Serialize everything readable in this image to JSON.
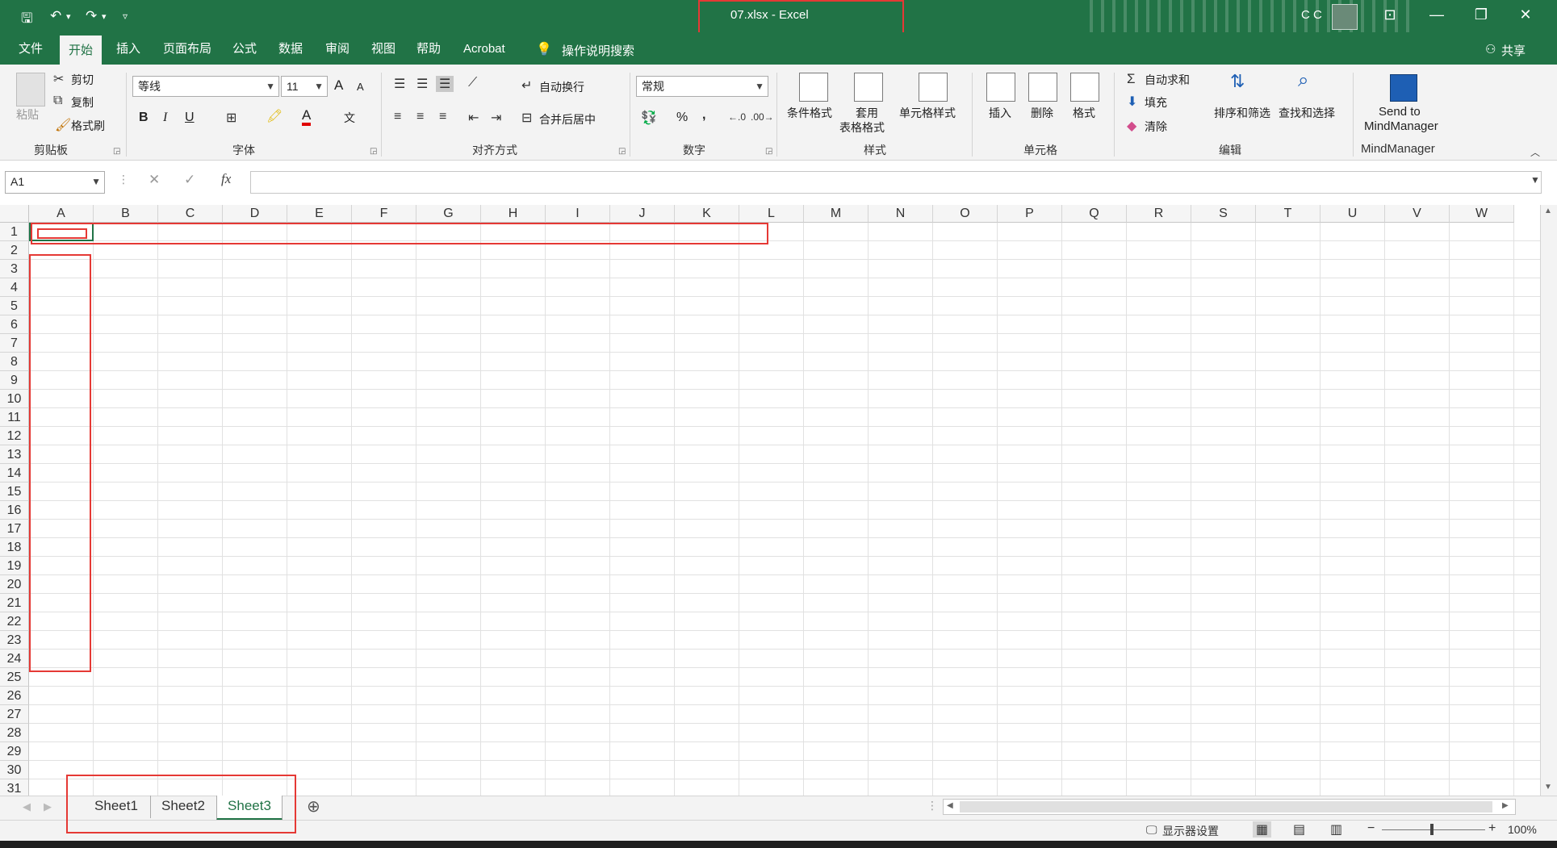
{
  "window": {
    "title": "07.xlsx  -  Excel",
    "user": "C C",
    "share_label": "共享"
  },
  "tabs": [
    "文件",
    "开始",
    "插入",
    "页面布局",
    "公式",
    "数据",
    "审阅",
    "视图",
    "帮助",
    "Acrobat"
  ],
  "active_tab": "开始",
  "tell_me": "操作说明搜索",
  "ribbon": {
    "clipboard": {
      "label": "剪贴板",
      "paste": "粘贴",
      "cut": "剪切",
      "copy": "复制",
      "format_painter": "格式刷"
    },
    "font": {
      "label": "字体",
      "font_name": "等线",
      "font_size": "11",
      "bold": "B",
      "italic": "I",
      "underline": "U",
      "grow": "A",
      "shrink": "A",
      "font_color_glyph": "A",
      "phonetic": "文"
    },
    "alignment": {
      "label": "对齐方式",
      "wrap": "自动换行",
      "merge": "合并后居中"
    },
    "number": {
      "label": "数字",
      "format": "常规",
      "percent": "%",
      "comma": ","
    },
    "styles": {
      "label": "样式",
      "conditional": "条件格式",
      "table_format_1": "套用",
      "table_format_2": "表格格式",
      "cell_styles": "单元格样式"
    },
    "cells": {
      "label": "单元格",
      "insert": "插入",
      "delete": "删除",
      "format": "格式"
    },
    "editing": {
      "label": "编辑",
      "autosum": "自动求和",
      "fill": "填充",
      "clear": "清除",
      "sort": "排序和筛选",
      "find": "查找和选择"
    },
    "mindmanager": {
      "label": "MindManager",
      "send_1": "Send to",
      "send_2": "MindManager"
    }
  },
  "formula_bar": {
    "name_box": "A1",
    "fx": "fx",
    "value": ""
  },
  "columns": [
    "A",
    "B",
    "C",
    "D",
    "E",
    "F",
    "G",
    "H",
    "I",
    "J",
    "K",
    "L",
    "M",
    "N",
    "O",
    "P",
    "Q",
    "R",
    "S",
    "T",
    "U",
    "V",
    "W"
  ],
  "rows": [
    "1",
    "2",
    "3",
    "4",
    "5",
    "6",
    "7",
    "8",
    "9",
    "10",
    "11",
    "12",
    "13",
    "14",
    "15",
    "16",
    "17",
    "18",
    "19",
    "20",
    "21",
    "22",
    "23",
    "24",
    "25",
    "26",
    "27",
    "28",
    "29",
    "30",
    "31"
  ],
  "sheets": [
    "Sheet1",
    "Sheet2",
    "Sheet3"
  ],
  "active_sheet": "Sheet3",
  "status": {
    "display_settings": "显示器设置",
    "zoom": "100%",
    "zoom_minus": "−",
    "zoom_plus": "+"
  },
  "colors": {
    "excel_green": "#217346",
    "highlight_red": "#e53935",
    "ribbon_bg": "#f3f3f3"
  }
}
